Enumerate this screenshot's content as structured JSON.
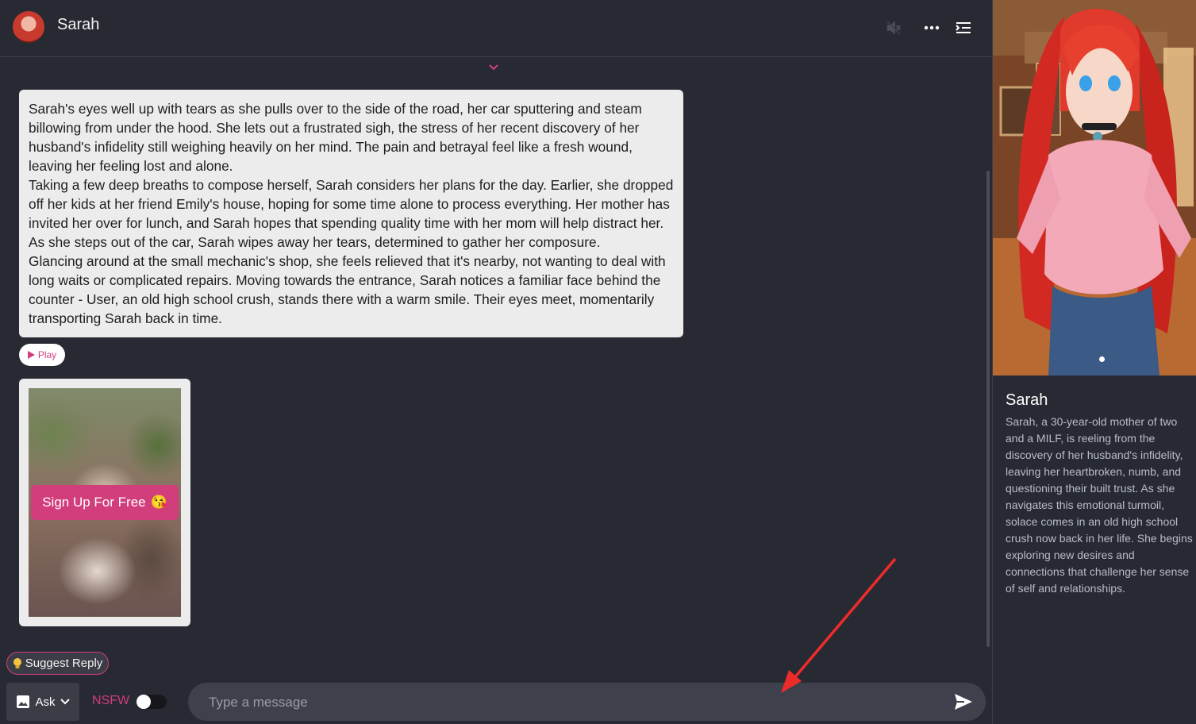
{
  "header": {
    "character_name": "Sarah",
    "icons": [
      "mute-icon",
      "more-icon",
      "menu-collapse-icon"
    ]
  },
  "message": {
    "paragraphs": [
      "Sarah's eyes well up with tears as she pulls over to the side of the road, her car sputtering and steam billowing from under the hood. She lets out a frustrated sigh, the stress of her recent discovery of her husband's infidelity still weighing heavily on her mind. The pain and betrayal feel like a fresh wound, leaving her feeling lost and alone.",
      "Taking a few deep breaths to compose herself, Sarah considers her plans for the day. Earlier, she dropped off her kids at her friend Emily's house, hoping for some time alone to process everything. Her mother has invited her over for lunch, and Sarah hopes that spending quality time with her mom will help distract her. As she steps out of the car, Sarah wipes away her tears, determined to gather her composure.",
      "Glancing around at the small mechanic's shop, she feels relieved that it's nearby, not wanting to deal with long waits or complicated repairs. Moving towards the entrance, Sarah notices a familiar face behind the counter - User, an old high school crush, stands there with a warm smile. Their eyes meet, momentarily transporting Sarah back in time."
    ],
    "play_label": "Play"
  },
  "image_card": {
    "signup_label": "Sign Up For Free",
    "signup_emoji": "😘"
  },
  "composer": {
    "suggest_label": "Suggest Reply",
    "ask_label": "Ask",
    "nsfw_label": "NSFW",
    "nsfw_on": false,
    "placeholder": "Type a message"
  },
  "profile": {
    "name": "Sarah",
    "description": "Sarah, a 30-year-old mother of two and a MILF, is reeling from the discovery of her husband's infidelity, leaving her heartbroken, numb, and questioning their built trust. As she navigates this emotional turmoil, solace comes in an old high school crush now back in her life. She begins exploring new desires and connections that challenge her sense of self and relationships."
  },
  "colors": {
    "accent": "#d23d7c",
    "background": "#282a33",
    "bubble": "#ececec",
    "annotation_arrow": "#ee2b2b"
  }
}
